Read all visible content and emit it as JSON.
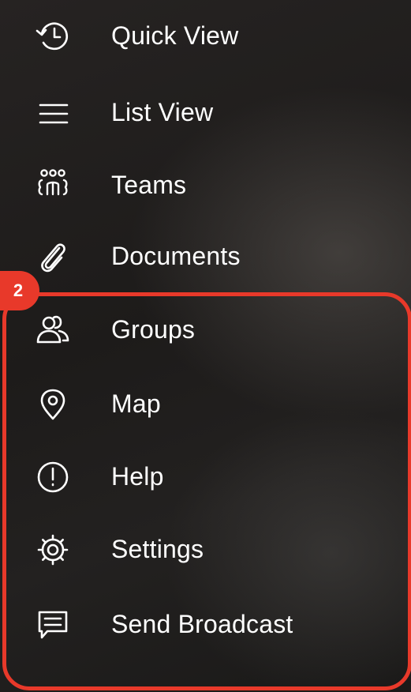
{
  "menu": {
    "items": [
      {
        "label": "Quick View",
        "icon": "history-icon"
      },
      {
        "label": "List View",
        "icon": "list-icon"
      },
      {
        "label": "Teams",
        "icon": "teams-icon"
      },
      {
        "label": "Documents",
        "icon": "paperclip-icon"
      },
      {
        "label": "Groups",
        "icon": "groups-icon"
      },
      {
        "label": "Map",
        "icon": "map-pin-icon"
      },
      {
        "label": "Help",
        "icon": "help-icon"
      },
      {
        "label": "Settings",
        "icon": "gear-icon"
      },
      {
        "label": "Send Broadcast",
        "icon": "broadcast-message-icon"
      }
    ]
  },
  "annotation": {
    "step_badge": "2",
    "highlight_color": "#e8392a"
  },
  "colors": {
    "background": "#1f1d1c",
    "text": "#ffffff"
  }
}
